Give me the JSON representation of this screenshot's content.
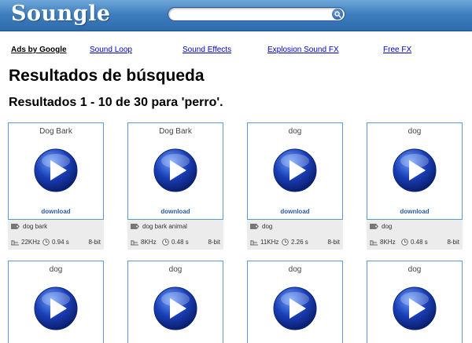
{
  "header": {
    "logo": "Soungle",
    "search_value": ""
  },
  "ads": {
    "label": "Ads by Google",
    "links": [
      "Sound Loop",
      "Sound Effects",
      "Explosion Sound FX",
      "Free FX"
    ]
  },
  "page": {
    "title": "Resultados de búsqueda",
    "results_summary": "Resultados 1 - 10 de 30 para 'perro'."
  },
  "results": [
    {
      "title": "Dog Bark",
      "download": "download",
      "tag": "dog bark",
      "rate": "22KHz",
      "duration": "0.94 s",
      "bits": "8-bit"
    },
    {
      "title": "Dog Bark",
      "download": "download",
      "tag": "dog bark animal",
      "rate": "8KHz",
      "duration": "0.48 s",
      "bits": "8-bit"
    },
    {
      "title": "dog",
      "download": "download",
      "tag": "dog",
      "rate": "11KHz",
      "duration": "2.26 s",
      "bits": "8-bit"
    },
    {
      "title": "dog",
      "download": "download",
      "tag": "dog",
      "rate": "8KHz",
      "duration": "0.48 s",
      "bits": "8-bit"
    },
    {
      "title": "dog"
    },
    {
      "title": "dog"
    },
    {
      "title": "dog"
    },
    {
      "title": "dog"
    }
  ],
  "colors": {
    "header_top": "#6ea6d8",
    "header_bottom": "#2d6aab",
    "card_border": "#5b9ad0",
    "link": "#0000cc",
    "meta_bg": "#ececec"
  },
  "icons": {
    "search": "magnifier-icon",
    "play": "play-icon",
    "tag": "tag-icon",
    "rate": "waveform-icon",
    "duration": "clock-icon"
  }
}
